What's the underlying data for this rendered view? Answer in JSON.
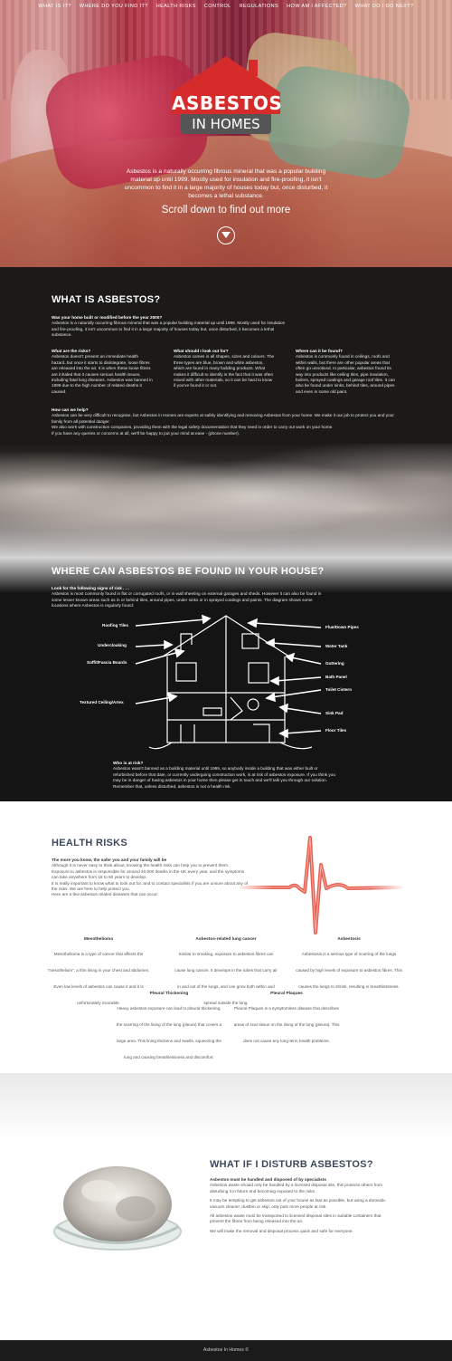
{
  "nav": [
    "WHAT IS IT?",
    "WHERE DO YOU FIND IT?",
    "HEALTH RISKS",
    "CONTROL",
    "REGULATIONS",
    "HOW AM I AFFECTED?",
    "WHAT DO I DO NEXT?"
  ],
  "logo": {
    "line1": "ASBESTOS",
    "line2": "IN HOMES"
  },
  "hero": {
    "text": "Asbestos is a naturally occurring fibrous mineral that was a popular building material up until 1999. Mostly used for insulation and fire-proofing, it isn't uncommon to find it in a large majority of houses today but, once disturbed, it becomes a lethal substance.",
    "scroll_label": "Scroll down to find out more"
  },
  "what": {
    "title": "WHAT IS ASBESTOS?",
    "q1": "Was your home built or modified before the year 2000?",
    "a1": "Asbestos is a naturally occurring fibrous mineral that was a popular building material up until 1999. Mostly used for insulation and fire-proofing, it isn't uncommon to find it in a large majority of houses today but, once disturbed, it becomes a lethal substance.",
    "cols": [
      {
        "h": "What are the risks?",
        "b": "Asbestos doesn't present an immediate health hazard, but once it starts to disintegrate, loose fibres are released into the air. It is when these loose fibres are inhaled that it causes serious health issues, including fatal lung diseases. Asbestos was banned in 1999 due to the high number of related deaths it caused."
      },
      {
        "h": "What should I look out for?",
        "b": "Asbestos comes in all shapes, sizes and colours. The three types are blue, brown and white asbestos, which are found in many building products. What makes it difficult to identify is the fact that it was often mixed with other materials, so it can be hard to know if you've found it or not."
      },
      {
        "h": "Where can it be found?",
        "b": "Asbestos is commonly found in ceilings, roofs and within walls, but there are other popular areas that often go unnoticed. In particular, asbestos found its way into products like ceiling tiles, pipe insulation, boilers, sprayed coatings and garage roof tiles. It can also be found under sinks, behind tiles, around pipes and even in some old paint."
      }
    ],
    "help_h": "How can we help?",
    "help_b1": "Asbestos can be very difficult to recognise, but Asbestos in Homes are experts at safely identifying and removing Asbestos from your home. We make it our job to protect you and your family from all potential danger.",
    "help_b2": "We also work with construction companies, providing them with the legal safety documentation that they need in order to carry out work on your home.",
    "help_b3": "If you have any queries or concerns at all, we'll be happy to put your mind at ease - (phone number)."
  },
  "where": {
    "title": "WHERE CAN ASBESTOS BE FOUND IN YOUR HOUSE?",
    "intro_h": "Look for the following signs of risk . . .",
    "intro_b": "Asbestos is most commonly found in flat or corrugated roofs, or in wall sheeting on external garages and sheds. However it can also be found in some lesser known areas such as in or behind tiles, around pipes, under sinks or in sprayed coatings and paints. The diagram shows some locations where Asbestos is regularly found:",
    "labels_left": [
      "Roofing Tiles",
      "Undercloaking",
      "Soffit/Fascia Boards",
      "Textured Ceiling/Artex"
    ],
    "labels_right": [
      "Flue/Down Pipes",
      "Water Tank",
      "Guttering",
      "Bath Panel",
      "Toilet Cistern",
      "Sink Pad",
      "Floor Tiles"
    ],
    "risk_h": "Who is at risk?",
    "risk_b": "Asbestos wasn't banned as a building material until 1999, so anybody inside a building that was either built or refurbished before that date, or currently undergoing construction work, is at risk of asbestos exposure. If you think you may be in danger of having asbestos in your home then please get in touch and we'll talk you through our solution. Remember that, unless disturbed, asbestos is not a health risk."
  },
  "health": {
    "title": "HEALTH RISKS",
    "intro_h": "The more you know, the safer you and your family will be",
    "intro_b1": "Although it is never easy to think about, knowing the health risks can help you to prevent them.",
    "intro_b2": "Exposure to asbestos is responsible for around 40,000 deaths in the UK every year, and the symptoms can take anywhere from 15 to 60 years to develop.",
    "intro_b3": "It is really important to know what to look out for, and to contact specialists if you are unsure about any of the risks. We are here to help protect you.",
    "intro_b4": "Here are a few asbestos related diseases that can occur:",
    "diseases": [
      {
        "h": "Mesothelioma",
        "b": "Mesothelioma is a type of cancer that affects the \"mesothelium\", a thin lining in your chest and abdomen. Even low levels of asbestos can cause it and it is unfortunately incurable."
      },
      {
        "h": "Asbestos-related lung cancer",
        "b": "Similar to smoking, exposure to asbestos fibres can cause lung cancer. It develops in the tubes that carry air in and out of the lungs, and can grow both within and spread outside the lung."
      },
      {
        "h": "Asbestosis",
        "b": "Asbestosis is a serious type of scarring of the lungs caused by high levels of exposure to asbestos fibres. This causes the lungs to shrink, resulting in breathlessness."
      },
      {
        "h": "Pleural Thickening",
        "b": "Heavy asbestos exposure can lead to pleural thickening, the scarring of the lining of the lung (pleura) that covers a large area. This lining thickens and swells, squeezing the lung and causing breathlessness and discomfort."
      },
      {
        "h": "Pleural Plaques",
        "b": "Pleural Plaques is a symptomless disease that describes areas of scar tissue on the lining of the lung (pleura). This does not cause any long-term health problems."
      }
    ]
  },
  "disturb": {
    "title": "WHAT IF I DISTURB ASBESTOS?",
    "h": "Asbestos must be handled and disposed of by specialists",
    "p1": "Asbestos waste should only be handled by a licensed disposal site, this protects others from disturbing it in future and becoming exposed to the risks.",
    "p2": "It may be tempting to get asbestos out of your house as fast as possible, but using a domestic vacuum cleaner, dustbin or skip, only puts more people at risk.",
    "p3": "All asbestos waste must be transported to licensed disposal sites in suitable containers that prevent the fibres from being released into the air.",
    "p4": "We will make the removal and disposal process quick and safe for everyone."
  },
  "footer": {
    "text": "Asbestos In Homes ©"
  },
  "colors": {
    "brand_red": "#d62b2b",
    "dark_bg": "#1b1a19",
    "heading_blue": "#3d4a5c",
    "pulse_red": "#e03a2a"
  },
  "icons": [
    "scroll-down-icon",
    "house-diagram",
    "heartbeat-line",
    "asbestos-dish-image"
  ]
}
